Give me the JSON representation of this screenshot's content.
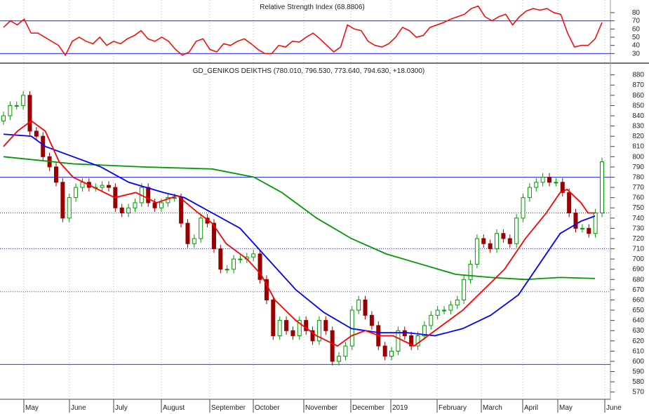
{
  "chart_data": [
    {
      "type": "line",
      "title": "Relative Strength Index",
      "title_value": "(68.8806)",
      "yticks": [
        30,
        40,
        50,
        60,
        70,
        80
      ],
      "ylim": [
        20,
        92
      ],
      "levels": [
        70,
        30
      ],
      "series": [
        {
          "name": "RSI",
          "color": "#ff0000",
          "values": [
            62,
            70,
            65,
            72,
            55,
            55,
            50,
            45,
            40,
            28,
            45,
            50,
            45,
            42,
            50,
            40,
            45,
            42,
            48,
            52,
            58,
            48,
            45,
            50,
            45,
            35,
            28,
            32,
            45,
            48,
            35,
            32,
            42,
            40,
            45,
            48,
            42,
            35,
            30,
            30,
            40,
            38,
            45,
            44,
            50,
            55,
            48,
            40,
            32,
            38,
            65,
            60,
            58,
            45,
            40,
            38,
            42,
            50,
            62,
            58,
            50,
            52,
            62,
            65,
            68,
            72,
            75,
            78,
            85,
            88,
            75,
            70,
            75,
            78,
            65,
            75,
            82,
            85,
            83,
            85,
            80,
            78,
            55,
            38,
            40,
            40,
            48,
            68
          ]
        }
      ]
    },
    {
      "type": "candlestick",
      "title": "GD_GENIKOS DEIKTHS",
      "title_values": "(780.010, 796.530, 773.640, 794.630, +18.0300)",
      "yticks": [
        570,
        580,
        590,
        600,
        610,
        620,
        630,
        640,
        650,
        660,
        670,
        680,
        690,
        700,
        710,
        720,
        730,
        740,
        750,
        760,
        770,
        780,
        790,
        800,
        810,
        820,
        830,
        840,
        850,
        860,
        870,
        880
      ],
      "ylim": [
        565,
        888
      ],
      "xticks": [
        "May",
        "June",
        "July",
        "August",
        "September",
        "October",
        "November",
        "December",
        "2019",
        "February",
        "March",
        "April",
        "May",
        "June"
      ],
      "hlines": [
        {
          "value": 780,
          "style": "solid"
        },
        {
          "value": 745,
          "style": "dotted"
        },
        {
          "value": 710,
          "style": "dotted"
        },
        {
          "value": 668,
          "style": "dotted"
        },
        {
          "value": 597,
          "style": "solid"
        }
      ],
      "closes": [
        840,
        850,
        850,
        860,
        825,
        820,
        800,
        790,
        775,
        740,
        760,
        770,
        775,
        770,
        770,
        772,
        770,
        750,
        745,
        750,
        755,
        770,
        755,
        750,
        755,
        760,
        760,
        735,
        715,
        720,
        740,
        735,
        710,
        690,
        690,
        700,
        700,
        702,
        705,
        680,
        660,
        625,
        640,
        630,
        625,
        640,
        630,
        620,
        640,
        630,
        600,
        605,
        615,
        650,
        660,
        645,
        635,
        615,
        605,
        610,
        630,
        625,
        615,
        625,
        635,
        645,
        650,
        650,
        655,
        660,
        680,
        695,
        720,
        715,
        710,
        725,
        720,
        715,
        740,
        760,
        770,
        775,
        780,
        775,
        775,
        765,
        745,
        730,
        730,
        725,
        745,
        795
      ],
      "ma": [
        {
          "name": "MA200",
          "color": "#009900",
          "points": [
            [
              0,
              800
            ],
            [
              10,
              793
            ],
            [
              20,
              790
            ],
            [
              30,
              788
            ],
            [
              36,
              780
            ],
            [
              40,
              765
            ],
            [
              45,
              740
            ],
            [
              50,
              720
            ],
            [
              55,
              705
            ],
            [
              60,
              695
            ],
            [
              65,
              685
            ],
            [
              70,
              682
            ],
            [
              75,
              680
            ],
            [
              80,
              682
            ],
            [
              85,
              681
            ]
          ]
        },
        {
          "name": "MA50",
          "color": "#0000ff",
          "points": [
            [
              0,
              822
            ],
            [
              4,
              820
            ],
            [
              6,
              810
            ],
            [
              10,
              800
            ],
            [
              14,
              790
            ],
            [
              18,
              775
            ],
            [
              23,
              765
            ],
            [
              26,
              760
            ],
            [
              30,
              745
            ],
            [
              34,
              730
            ],
            [
              38,
              700
            ],
            [
              42,
              670
            ],
            [
              46,
              648
            ],
            [
              50,
              632
            ],
            [
              54,
              628
            ],
            [
              58,
              628
            ],
            [
              62,
              625
            ],
            [
              66,
              632
            ],
            [
              70,
              645
            ],
            [
              74,
              665
            ],
            [
              77,
              695
            ],
            [
              80,
              725
            ],
            [
              83,
              737
            ],
            [
              85,
              742
            ]
          ]
        },
        {
          "name": "MA20",
          "color": "#ff0000",
          "points": [
            [
              0,
              810
            ],
            [
              2,
              825
            ],
            [
              4,
              835
            ],
            [
              6,
              825
            ],
            [
              8,
              795
            ],
            [
              10,
              780
            ],
            [
              13,
              770
            ],
            [
              16,
              760
            ],
            [
              19,
              765
            ],
            [
              22,
              755
            ],
            [
              25,
              762
            ],
            [
              28,
              745
            ],
            [
              30,
              735
            ],
            [
              32,
              715
            ],
            [
              35,
              700
            ],
            [
              37,
              685
            ],
            [
              39,
              660
            ],
            [
              42,
              640
            ],
            [
              45,
              625
            ],
            [
              48,
              615
            ],
            [
              50,
              625
            ],
            [
              52,
              630
            ],
            [
              54,
              625
            ],
            [
              56,
              625
            ],
            [
              59,
              615
            ],
            [
              62,
              630
            ],
            [
              66,
              650
            ],
            [
              69,
              670
            ],
            [
              72,
              690
            ],
            [
              75,
              720
            ],
            [
              78,
              745
            ],
            [
              80,
              765
            ],
            [
              81,
              768
            ],
            [
              83,
              755
            ],
            [
              84,
              745
            ],
            [
              85,
              745
            ]
          ]
        }
      ]
    }
  ]
}
